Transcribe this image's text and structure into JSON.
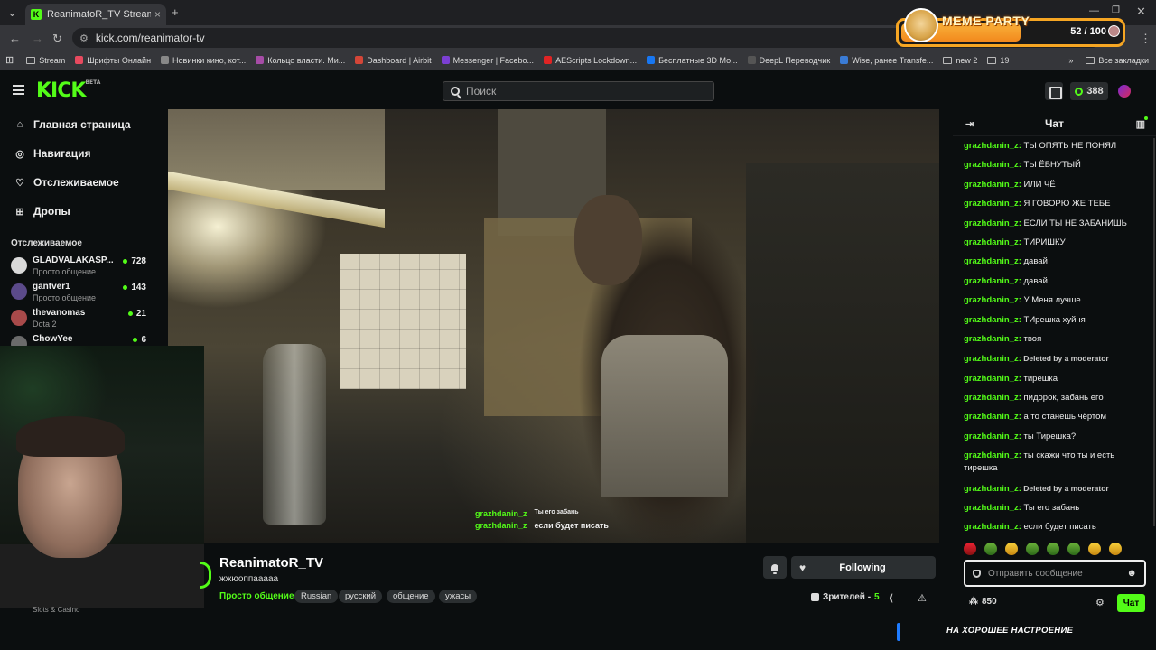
{
  "browser": {
    "tab_title": "ReanimatoR_TV Stream - W",
    "tab_close": "×",
    "new_tab": "+",
    "url": "kick.com/reanimator-tv",
    "bookmarks": [
      {
        "label": "Stream",
        "type": "folder"
      },
      {
        "label": "Шрифты Онлайн",
        "type": "site",
        "color": "#e84a5f"
      },
      {
        "label": "Новинки кино, кот...",
        "type": "site",
        "color": "#888888"
      },
      {
        "label": "Кольцо власти. Ми...",
        "type": "site",
        "color": "#a64ca6"
      },
      {
        "label": "Dashboard | Airbit",
        "type": "site",
        "color": "#d44638"
      },
      {
        "label": "Messenger | Facebo...",
        "type": "site",
        "color": "#7b3fd3"
      },
      {
        "label": "AEScripts Lockdown...",
        "type": "site",
        "color": "#e02424"
      },
      {
        "label": "Бесплатные 3D Мо...",
        "type": "site",
        "color": "#1877f2"
      },
      {
        "label": "DeepL Переводчик",
        "type": "site",
        "color": "#555555"
      },
      {
        "label": "Wise, ранее Transfe...",
        "type": "site",
        "color": "#3a7bd5"
      },
      {
        "label": "new 2",
        "type": "folder"
      },
      {
        "label": "19",
        "type": "folder"
      }
    ],
    "all_bookmarks": "Все закладки"
  },
  "meme_widget": {
    "label": "MEME PARTY",
    "count": "52 / 100"
  },
  "header": {
    "logo": "KICK",
    "logo_badge": "BETA",
    "search_placeholder": "Поиск",
    "points": "388"
  },
  "sidebar": {
    "nav": [
      {
        "label": "Главная страница",
        "icon": "home-icon",
        "glyph": "⌂"
      },
      {
        "label": "Навигация",
        "icon": "compass-icon",
        "glyph": "◎"
      },
      {
        "label": "Отслеживаемое",
        "icon": "heart-icon",
        "glyph": "♡"
      },
      {
        "label": "Дропы",
        "icon": "gift-icon",
        "glyph": "⊞"
      }
    ],
    "following_title": "Отслеживаемое",
    "following": [
      {
        "name": "GLADVALAKASP...",
        "category": "Просто общение",
        "viewers": "728",
        "color": "#d9d9d9"
      },
      {
        "name": "gantver1",
        "category": "Просто общение",
        "viewers": "143",
        "color": "#5b4a8a"
      },
      {
        "name": "thevanomas",
        "category": "Dota 2",
        "viewers": "21",
        "color": "#a84a4a"
      },
      {
        "name": "ChowYee",
        "category": "",
        "viewers": "6",
        "color": "#6b6b6b"
      }
    ],
    "slots_label": "Slots & Casino"
  },
  "stream": {
    "overlay_chat": [
      {
        "user": "grazhdanin_z",
        "text": "Ты его забань"
      },
      {
        "user": "grazhdanin_z",
        "text": "если будет писать"
      }
    ],
    "channel_name": "ReanimatoR_TV",
    "title": "жжюоппааааа",
    "category": "Просто общение",
    "tags": [
      "Russian",
      "русский",
      "общение",
      "ужасы"
    ],
    "follow_label": "Following",
    "viewers_label": "Зрителей -",
    "viewers_count": "5"
  },
  "chat": {
    "title": "Чат",
    "messages": [
      {
        "user": "grazhdanin_z:",
        "text": " ТЫ ОПЯТЬ НЕ ПОНЯЛ"
      },
      {
        "user": "grazhdanin_z:",
        "text": " ТЫ ЁБНУТЫЙ"
      },
      {
        "user": "grazhdanin_z:",
        "text": " ИЛИ ЧЁ"
      },
      {
        "user": "grazhdanin_z:",
        "text": " Я ГОВОРЮ ЖЕ ТЕБЕ"
      },
      {
        "user": "grazhdanin_z:",
        "text": " ЕСЛИ ТЫ НЕ ЗАБАНИШЬ"
      },
      {
        "user": "grazhdanin_z:",
        "text": " ТИРИШКУ"
      },
      {
        "user": "grazhdanin_z:",
        "text": " давай"
      },
      {
        "user": "grazhdanin_z:",
        "text": " давай"
      },
      {
        "user": "grazhdanin_z:",
        "text": " У Меня лучше"
      },
      {
        "user": "grazhdanin_z:",
        "text": " ТИрешка хуйня"
      },
      {
        "user": "grazhdanin_z:",
        "text": " твоя"
      },
      {
        "user": "grazhdanin_z:",
        "text": " Deleted by a moderator",
        "deleted": true
      },
      {
        "user": "grazhdanin_z:",
        "text": " тирешка"
      },
      {
        "user": "grazhdanin_z:",
        "text": " пидорок, забань его"
      },
      {
        "user": "grazhdanin_z:",
        "text": " а то станешь чёртом"
      },
      {
        "user": "grazhdanin_z:",
        "text": " ты Тирешка?"
      },
      {
        "user": "grazhdanin_z:",
        "text": " ты скажи что ты и есть тирешка"
      },
      {
        "user": "grazhdanin_z:",
        "text": " Deleted by a moderator",
        "deleted": true
      },
      {
        "user": "grazhdanin_z:",
        "text": " Ты его забань"
      },
      {
        "user": "grazhdanin_z:",
        "text": " если будет писать"
      }
    ],
    "input_placeholder": "Отправить сообщение",
    "points": "850",
    "send_label": "Чат"
  },
  "overlay_banner": "НА ХОРОШЕЕ НАСТРОЕНИЕ",
  "colors": {
    "accent": "#53fc18",
    "background": "#0b0e0f",
    "meme_border": "#f6a623"
  }
}
